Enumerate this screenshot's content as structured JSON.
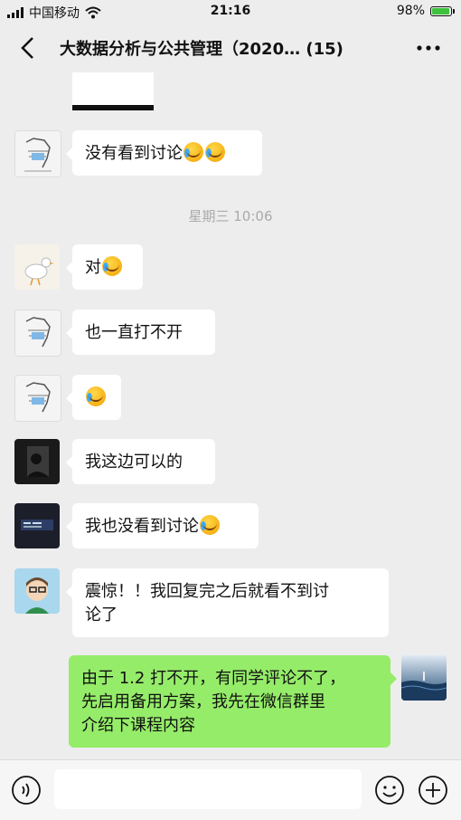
{
  "status_bar": {
    "carrier": "中国移动",
    "time": "21:16",
    "battery": "98%",
    "battery_level": 0.98
  },
  "header": {
    "title": "大数据分析与公共管理（2020…",
    "member_count": "(15)"
  },
  "timestamp": "星期三 10:06",
  "messages": [
    {
      "side": "left",
      "text": "没有看到讨论",
      "emoji_count": 2
    },
    {
      "side": "left",
      "text": "对",
      "emoji_count": 1
    },
    {
      "side": "left",
      "text": "也一直打不开",
      "emoji_count": 0
    },
    {
      "side": "left",
      "text": "",
      "emoji_count": 1
    },
    {
      "side": "left",
      "text": "我这边可以的",
      "emoji_count": 0
    },
    {
      "side": "left",
      "text": "我也没看到讨论",
      "emoji_count": 1
    },
    {
      "side": "left",
      "text_line1": "震惊！！我回复完之后就看不到讨",
      "text_line2": "论了"
    },
    {
      "side": "right",
      "text_line1": "由于 1.2 打不开，有同学评论不了，",
      "text_line2": "先启用备用方案，我先在微信群里",
      "text_line3": "介绍下课程内容"
    }
  ],
  "colors": {
    "background": "#ededed",
    "self_bubble": "#95ec69",
    "other_bubble": "#ffffff"
  }
}
